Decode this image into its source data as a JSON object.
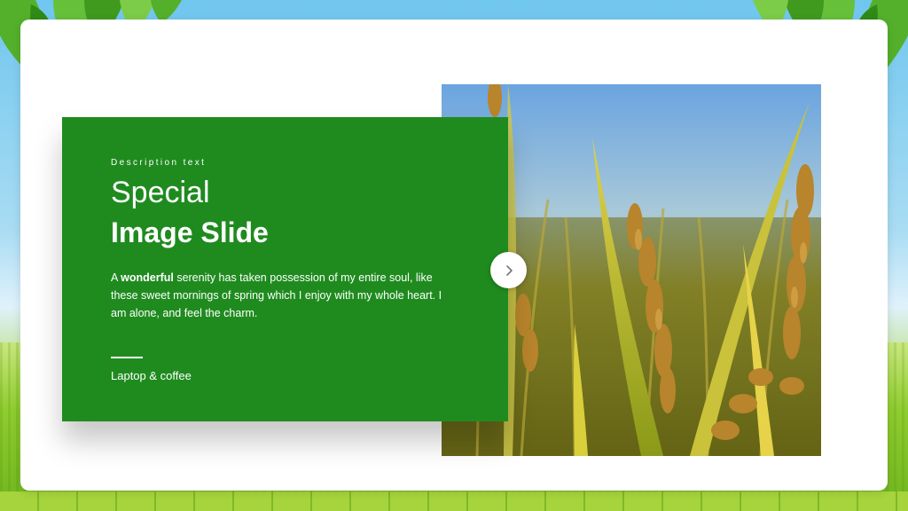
{
  "slide": {
    "description_label": "Description text",
    "title_line1": "Special",
    "title_line2": "Image Slide",
    "body_bold": "wonderful",
    "body_prefix": "A ",
    "body_rest": " serenity has taken possession of my entire soul, like these sweet mornings of spring which I enjoy with my whole heart. I am alone, and feel the charm.",
    "caption": "Laptop & coffee"
  },
  "controls": {
    "next_icon": "chevron-right-icon"
  },
  "colors": {
    "panel_green": "#1f8b1f",
    "card_white": "#ffffff",
    "sky": "#6fc6ee",
    "grass": "#7cc12f"
  },
  "image": {
    "subject": "rice-field-photo"
  }
}
